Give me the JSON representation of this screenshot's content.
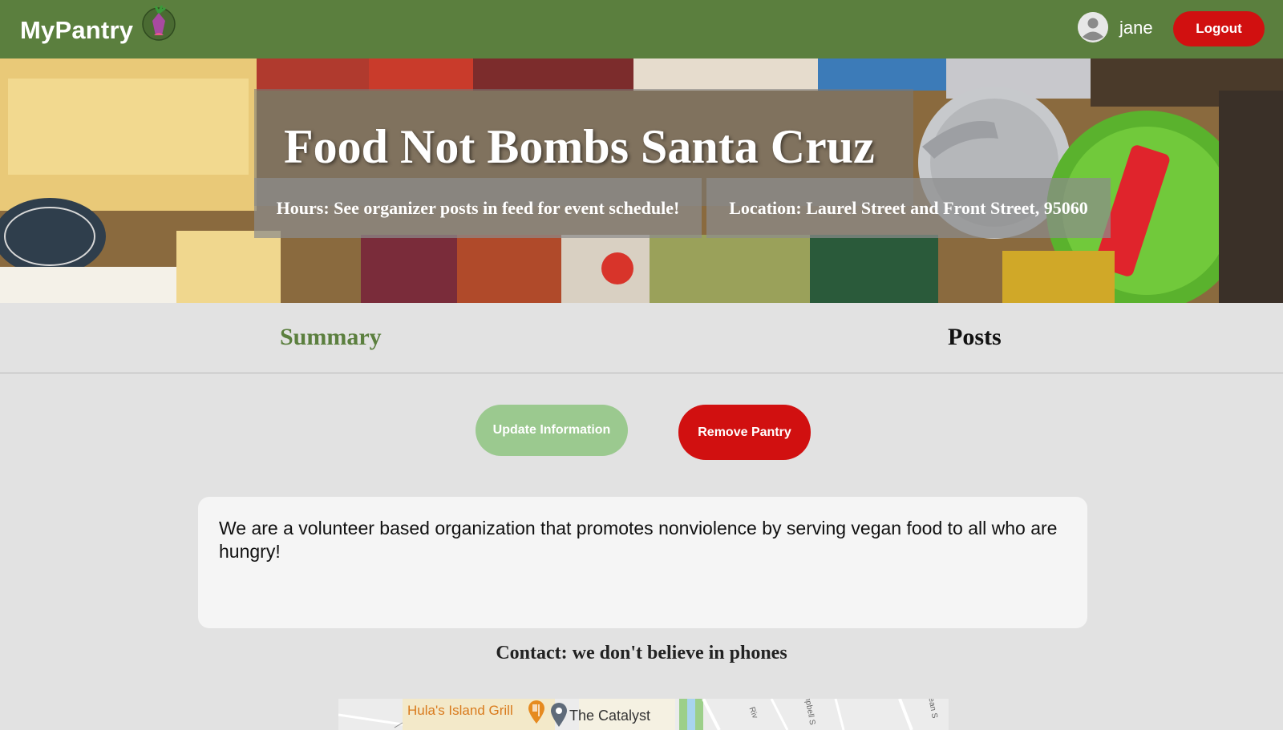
{
  "nav": {
    "brand": "MyPantry",
    "username": "jane",
    "logout_label": "Logout"
  },
  "hero": {
    "title": "Food Not Bombs Santa Cruz",
    "hours": "Hours: See organizer posts in feed for event schedule!",
    "location": "Location: Laurel Street and Front Street, 95060"
  },
  "tabs": {
    "summary": "Summary",
    "posts": "Posts",
    "active": "summary"
  },
  "actions": {
    "update_label": "Update Information",
    "remove_label": "Remove Pantry"
  },
  "description": "We are a volunteer based organization that promotes nonviolence by serving vegan food to all who are hungry!",
  "contact": "Contact: we don't believe in phones",
  "map": {
    "place_1": "Hula's Island Grill",
    "place_2": "The Catalyst",
    "street_1": "Riv",
    "street_2": "mpbell S",
    "street_3": "ean S"
  },
  "colors": {
    "nav_green": "#5b7f3e",
    "danger_red": "#d11010",
    "update_green": "#9bc98f",
    "active_tab": "#5b7f3e"
  }
}
